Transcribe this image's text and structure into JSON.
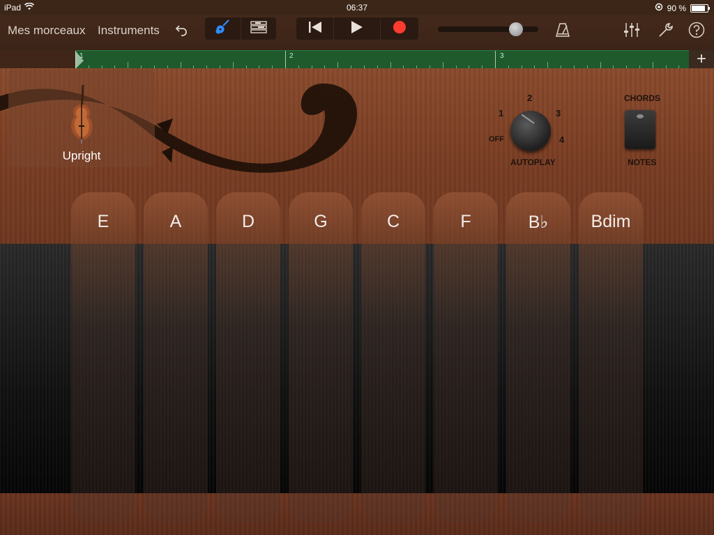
{
  "status": {
    "device": "iPad",
    "time": "06:37",
    "battery": "90 %"
  },
  "toolbar": {
    "songs_label": "Mes morceaux",
    "instruments_label": "Instruments",
    "tempo_level": 0.78
  },
  "ruler": {
    "bars": [
      "1",
      "2",
      "3"
    ]
  },
  "instrument": {
    "name": "Upright"
  },
  "autoplay": {
    "positions": [
      "OFF",
      "1",
      "2",
      "3",
      "4"
    ],
    "label": "AUTOPLAY",
    "selected": "OFF"
  },
  "mode": {
    "top_label": "CHORDS",
    "bottom_label": "NOTES"
  },
  "chords": [
    "E",
    "A",
    "D",
    "G",
    "C",
    "F",
    "B♭",
    "Bdim"
  ],
  "colors": {
    "record": "#ff3b30",
    "accent": "#2f8cff",
    "ruler": "#1f5a2d"
  }
}
